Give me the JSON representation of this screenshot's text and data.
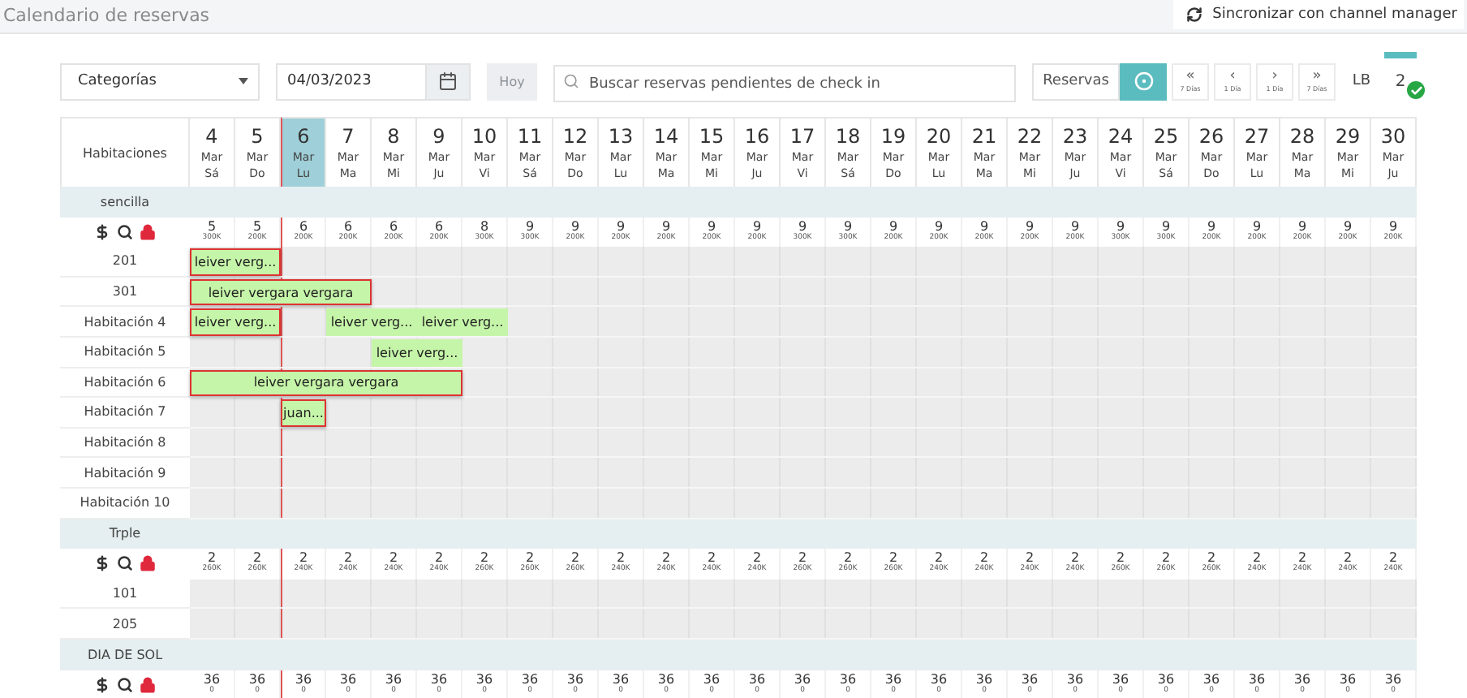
{
  "page_title": "Calendario de reservas",
  "sync_button": "Sincronizar con channel manager",
  "toolbar": {
    "category_select": "Categorías",
    "date": "04/03/2023",
    "today_button": {
      "label": "Hoy",
      "disabled": true
    },
    "search": {
      "placeholder": "Buscar reservas pendientes de check in"
    },
    "reservations_button": "Reservas",
    "eye_toggle": {
      "selected": true
    },
    "nav_buttons": [
      {
        "symbol": "«",
        "caption": "7 Días"
      },
      {
        "symbol": "‹",
        "caption": "1 Día"
      },
      {
        "symbol": "›",
        "caption": "1 Día"
      },
      {
        "symbol": "»",
        "caption": "7 Días"
      }
    ],
    "lb_label": "LB",
    "counter": {
      "value": "2",
      "checked": true
    }
  },
  "rooms_header": "Habitaciones",
  "days": [
    {
      "day": "4",
      "month": "Mar",
      "weekday": "Sá",
      "selected": false
    },
    {
      "day": "5",
      "month": "Mar",
      "weekday": "Do",
      "selected": false
    },
    {
      "day": "6",
      "month": "Mar",
      "weekday": "Lu",
      "selected": true
    },
    {
      "day": "7",
      "month": "Mar",
      "weekday": "Ma",
      "selected": false
    },
    {
      "day": "8",
      "month": "Mar",
      "weekday": "Mi",
      "selected": false
    },
    {
      "day": "9",
      "month": "Mar",
      "weekday": "Ju",
      "selected": false
    },
    {
      "day": "10",
      "month": "Mar",
      "weekday": "Vi",
      "selected": false
    },
    {
      "day": "11",
      "month": "Mar",
      "weekday": "Sá",
      "selected": false
    },
    {
      "day": "12",
      "month": "Mar",
      "weekday": "Do",
      "selected": false
    },
    {
      "day": "13",
      "month": "Mar",
      "weekday": "Lu",
      "selected": false
    },
    {
      "day": "14",
      "month": "Mar",
      "weekday": "Ma",
      "selected": false
    },
    {
      "day": "15",
      "month": "Mar",
      "weekday": "Mi",
      "selected": false
    },
    {
      "day": "16",
      "month": "Mar",
      "weekday": "Ju",
      "selected": false
    },
    {
      "day": "17",
      "month": "Mar",
      "weekday": "Vi",
      "selected": false
    },
    {
      "day": "18",
      "month": "Mar",
      "weekday": "Sá",
      "selected": false
    },
    {
      "day": "19",
      "month": "Mar",
      "weekday": "Do",
      "selected": false
    },
    {
      "day": "20",
      "month": "Mar",
      "weekday": "Lu",
      "selected": false
    },
    {
      "day": "21",
      "month": "Mar",
      "weekday": "Ma",
      "selected": false
    },
    {
      "day": "22",
      "month": "Mar",
      "weekday": "Mi",
      "selected": false
    },
    {
      "day": "23",
      "month": "Mar",
      "weekday": "Ju",
      "selected": false
    },
    {
      "day": "24",
      "month": "Mar",
      "weekday": "Vi",
      "selected": false
    },
    {
      "day": "25",
      "month": "Mar",
      "weekday": "Sá",
      "selected": false
    },
    {
      "day": "26",
      "month": "Mar",
      "weekday": "Do",
      "selected": false
    },
    {
      "day": "27",
      "month": "Mar",
      "weekday": "Lu",
      "selected": false
    },
    {
      "day": "28",
      "month": "Mar",
      "weekday": "Ma",
      "selected": false
    },
    {
      "day": "29",
      "month": "Mar",
      "weekday": "Mi",
      "selected": false
    },
    {
      "day": "30",
      "month": "Mar",
      "weekday": "Ju",
      "selected": false
    }
  ],
  "groups": [
    {
      "name": "sencilla",
      "availability": [
        {
          "count": "5",
          "price": "300K"
        },
        {
          "count": "5",
          "price": "200K"
        },
        {
          "count": "6",
          "price": "200K"
        },
        {
          "count": "6",
          "price": "200K"
        },
        {
          "count": "6",
          "price": "200K"
        },
        {
          "count": "6",
          "price": "200K"
        },
        {
          "count": "8",
          "price": "300K"
        },
        {
          "count": "9",
          "price": "300K"
        },
        {
          "count": "9",
          "price": "200K"
        },
        {
          "count": "9",
          "price": "200K"
        },
        {
          "count": "9",
          "price": "200K"
        },
        {
          "count": "9",
          "price": "200K"
        },
        {
          "count": "9",
          "price": "200K"
        },
        {
          "count": "9",
          "price": "300K"
        },
        {
          "count": "9",
          "price": "300K"
        },
        {
          "count": "9",
          "price": "200K"
        },
        {
          "count": "9",
          "price": "200K"
        },
        {
          "count": "9",
          "price": "200K"
        },
        {
          "count": "9",
          "price": "200K"
        },
        {
          "count": "9",
          "price": "200K"
        },
        {
          "count": "9",
          "price": "300K"
        },
        {
          "count": "9",
          "price": "300K"
        },
        {
          "count": "9",
          "price": "200K"
        },
        {
          "count": "9",
          "price": "200K"
        },
        {
          "count": "9",
          "price": "200K"
        },
        {
          "count": "9",
          "price": "200K"
        },
        {
          "count": "9",
          "price": "200K"
        }
      ],
      "rooms": [
        {
          "name": "201",
          "bookings": [
            {
              "guest": "leiver verg...",
              "outlined": true
            }
          ]
        },
        {
          "name": "301",
          "bookings": [
            {
              "guest": "leiver vergara vergara",
              "outlined": true
            }
          ]
        },
        {
          "name": "Habitación 4",
          "bookings": [
            {
              "guest": "leiver verg...",
              "outlined": true
            },
            {
              "guest": "leiver verg...",
              "outlined": false
            },
            {
              "guest": "leiver verg...",
              "outlined": false
            }
          ]
        },
        {
          "name": "Habitación 5",
          "bookings": [
            {
              "guest": "leiver verg...",
              "outlined": false
            }
          ]
        },
        {
          "name": "Habitación 6",
          "bookings": [
            {
              "guest": "leiver vergara vergara",
              "outlined": true
            }
          ]
        },
        {
          "name": "Habitación 7",
          "bookings": [
            {
              "guest": "juan...",
              "outlined": true
            }
          ]
        },
        {
          "name": "Habitación 8"
        },
        {
          "name": "Habitación 9"
        },
        {
          "name": "Habitación 10"
        }
      ]
    },
    {
      "name": "Trple",
      "availability": [
        {
          "count": "2",
          "price": "260K"
        },
        {
          "count": "2",
          "price": "260K"
        },
        {
          "count": "2",
          "price": "240K"
        },
        {
          "count": "2",
          "price": "240K"
        },
        {
          "count": "2",
          "price": "240K"
        },
        {
          "count": "2",
          "price": "240K"
        },
        {
          "count": "2",
          "price": "260K"
        },
        {
          "count": "2",
          "price": "260K"
        },
        {
          "count": "2",
          "price": "260K"
        },
        {
          "count": "2",
          "price": "240K"
        },
        {
          "count": "2",
          "price": "240K"
        },
        {
          "count": "2",
          "price": "240K"
        },
        {
          "count": "2",
          "price": "240K"
        },
        {
          "count": "2",
          "price": "260K"
        },
        {
          "count": "2",
          "price": "260K"
        },
        {
          "count": "2",
          "price": "260K"
        },
        {
          "count": "2",
          "price": "240K"
        },
        {
          "count": "2",
          "price": "240K"
        },
        {
          "count": "2",
          "price": "240K"
        },
        {
          "count": "2",
          "price": "240K"
        },
        {
          "count": "2",
          "price": "260K"
        },
        {
          "count": "2",
          "price": "260K"
        },
        {
          "count": "2",
          "price": "260K"
        },
        {
          "count": "2",
          "price": "240K"
        },
        {
          "count": "2",
          "price": "240K"
        },
        {
          "count": "2",
          "price": "240K"
        },
        {
          "count": "2",
          "price": "240K"
        }
      ],
      "rooms": [
        {
          "name": "101"
        },
        {
          "name": "205"
        }
      ]
    },
    {
      "name": "DIA DE SOL",
      "availability": [
        {
          "count": "36",
          "price": "0"
        },
        {
          "count": "36",
          "price": "0"
        },
        {
          "count": "36",
          "price": "0"
        },
        {
          "count": "36",
          "price": "0"
        },
        {
          "count": "36",
          "price": "0"
        },
        {
          "count": "36",
          "price": "0"
        },
        {
          "count": "36",
          "price": "0"
        },
        {
          "count": "36",
          "price": "0"
        },
        {
          "count": "36",
          "price": "0"
        },
        {
          "count": "36",
          "price": "0"
        },
        {
          "count": "36",
          "price": "0"
        },
        {
          "count": "36",
          "price": "0"
        },
        {
          "count": "36",
          "price": "0"
        },
        {
          "count": "36",
          "price": "0"
        },
        {
          "count": "36",
          "price": "0"
        },
        {
          "count": "36",
          "price": "0"
        },
        {
          "count": "36",
          "price": "0"
        },
        {
          "count": "36",
          "price": "0"
        },
        {
          "count": "36",
          "price": "0"
        },
        {
          "count": "36",
          "price": "0"
        },
        {
          "count": "36",
          "price": "0"
        },
        {
          "count": "36",
          "price": "0"
        },
        {
          "count": "36",
          "price": "0"
        },
        {
          "count": "36",
          "price": "0"
        },
        {
          "count": "36",
          "price": "0"
        },
        {
          "count": "36",
          "price": "0"
        },
        {
          "count": "36",
          "price": "0"
        }
      ]
    }
  ]
}
